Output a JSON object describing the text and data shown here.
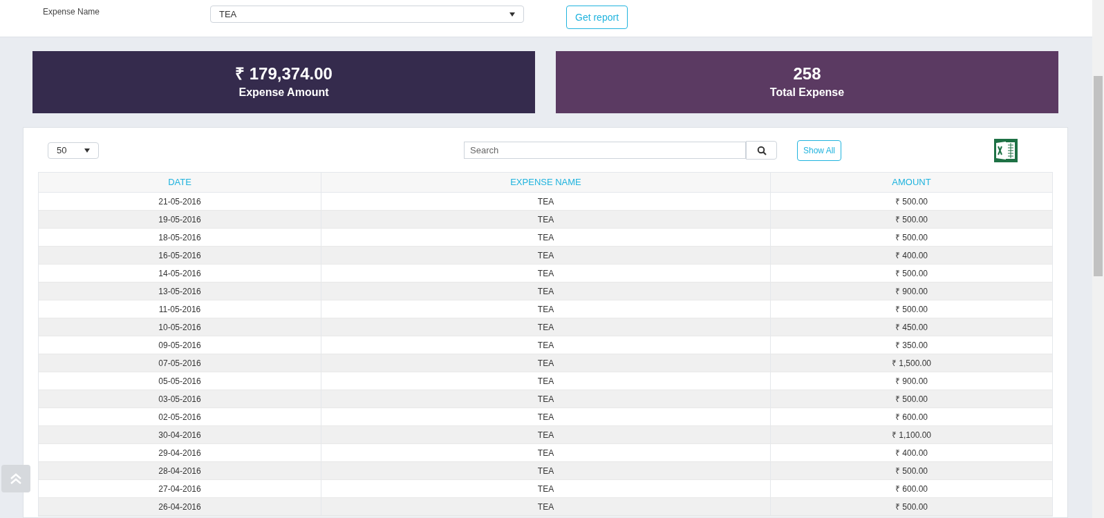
{
  "filter": {
    "label": "Expense Name",
    "value": "TEA",
    "button": "Get report"
  },
  "stats": [
    {
      "value": "₹ 179,374.00",
      "label": "Expense Amount",
      "color": "#352b4d"
    },
    {
      "value": "258",
      "label": "Total Expense",
      "color": "#5b3a62"
    }
  ],
  "controls": {
    "page_size": "50",
    "search_placeholder": "Search",
    "show_all": "Show All"
  },
  "table": {
    "columns": [
      "DATE",
      "EXPENSE NAME",
      "AMOUNT"
    ],
    "rows": [
      [
        "21-05-2016",
        "TEA",
        "₹ 500.00"
      ],
      [
        "19-05-2016",
        "TEA",
        "₹ 500.00"
      ],
      [
        "18-05-2016",
        "TEA",
        "₹ 500.00"
      ],
      [
        "16-05-2016",
        "TEA",
        "₹ 400.00"
      ],
      [
        "14-05-2016",
        "TEA",
        "₹ 500.00"
      ],
      [
        "13-05-2016",
        "TEA",
        "₹ 900.00"
      ],
      [
        "11-05-2016",
        "TEA",
        "₹ 500.00"
      ],
      [
        "10-05-2016",
        "TEA",
        "₹ 450.00"
      ],
      [
        "09-05-2016",
        "TEA",
        "₹ 350.00"
      ],
      [
        "07-05-2016",
        "TEA",
        "₹ 1,500.00"
      ],
      [
        "05-05-2016",
        "TEA",
        "₹ 900.00"
      ],
      [
        "03-05-2016",
        "TEA",
        "₹ 500.00"
      ],
      [
        "02-05-2016",
        "TEA",
        "₹ 600.00"
      ],
      [
        "30-04-2016",
        "TEA",
        "₹ 1,100.00"
      ],
      [
        "29-04-2016",
        "TEA",
        "₹ 400.00"
      ],
      [
        "28-04-2016",
        "TEA",
        "₹ 500.00"
      ],
      [
        "27-04-2016",
        "TEA",
        "₹ 600.00"
      ],
      [
        "26-04-2016",
        "TEA",
        "₹ 500.00"
      ]
    ]
  }
}
